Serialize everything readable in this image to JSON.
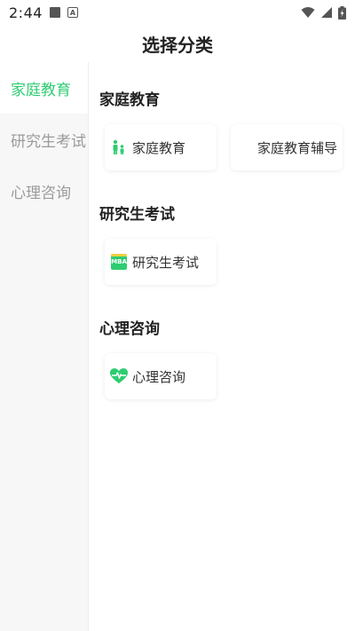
{
  "status_bar": {
    "time": "2:44"
  },
  "header": {
    "title": "选择分类"
  },
  "sidebar": {
    "items": [
      {
        "label": "家庭教育",
        "active": true
      },
      {
        "label": "研究生考试",
        "active": false
      },
      {
        "label": "心理咨询",
        "active": false
      }
    ]
  },
  "sections": [
    {
      "title": "家庭教育",
      "cards": [
        {
          "label": "家庭教育",
          "icon": "family-icon"
        },
        {
          "label": "家庭教育辅导",
          "icon": ""
        }
      ]
    },
    {
      "title": "研究生考试",
      "cards": [
        {
          "label": "研究生考试",
          "icon": "mba-icon",
          "icon_text": "MBA"
        }
      ]
    },
    {
      "title": "心理咨询",
      "cards": [
        {
          "label": "心理咨询",
          "icon": "heart-pulse-icon"
        }
      ]
    }
  ],
  "colors": {
    "accent": "#2ecc71",
    "sidebar_bg": "#f7f7f7",
    "inactive_text": "#9b9b9b"
  }
}
